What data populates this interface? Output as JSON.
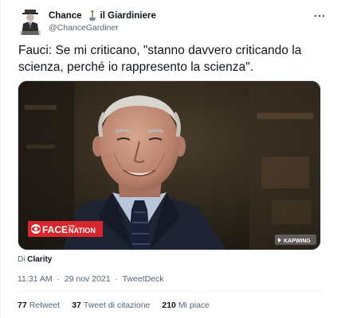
{
  "tweet": {
    "author": {
      "name_before_icon": "Chance",
      "name_icon": "gardening-tool-icon",
      "name_after_icon": "il Giardiniere",
      "handle": "@ChanceGardiner"
    },
    "text_line1": "Fauci: Se mi criticano, \"stanno davvero criticando la",
    "text_line2": "scienza, perché io rappresento la scienza\".",
    "media": {
      "logo_prefix": "FACE",
      "logo_word_the": "THE",
      "logo_suffix": "NATION",
      "watermark": "KAPWING"
    },
    "via_prefix": "Di",
    "via_source": "Clarity",
    "time": "11:31 AM",
    "date": "29 nov 2021",
    "client": "TweetDeck",
    "separator": "·",
    "stats": {
      "retweets_count": "77",
      "retweets_label": "Retweet",
      "quotes_count": "37",
      "quotes_label": "Tweet di citazione",
      "likes_count": "210",
      "likes_label": "Mi piace"
    }
  },
  "colors": {
    "text_primary": "#0f1419",
    "text_secondary": "#536471",
    "divider": "#eff3f4",
    "cbs_red": "#d7262e"
  }
}
